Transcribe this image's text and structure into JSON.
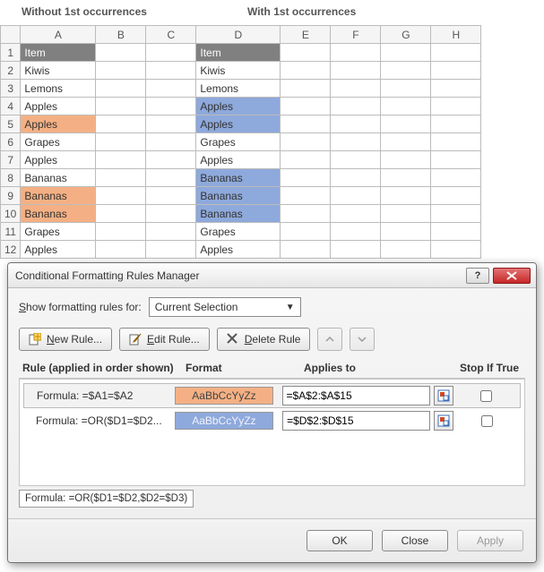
{
  "titles": {
    "left": "Without 1st occurrences",
    "right": "With 1st occurrences"
  },
  "grid": {
    "columns": [
      "A",
      "B",
      "C",
      "D",
      "E",
      "F",
      "G",
      "H"
    ],
    "header_label": "Item",
    "rows": [
      {
        "n": 1,
        "a": "Item",
        "d": "Item",
        "a_hdr": true,
        "d_hdr": true
      },
      {
        "n": 2,
        "a": "Kiwis",
        "d": "Kiwis"
      },
      {
        "n": 3,
        "a": "Lemons",
        "d": "Lemons"
      },
      {
        "n": 4,
        "a": "Apples",
        "d": "Apples",
        "d_hl": "blue"
      },
      {
        "n": 5,
        "a": "Apples",
        "d": "Apples",
        "a_hl": "orange",
        "d_hl": "blue"
      },
      {
        "n": 6,
        "a": "Grapes",
        "d": "Grapes"
      },
      {
        "n": 7,
        "a": "Apples",
        "d": "Apples"
      },
      {
        "n": 8,
        "a": "Bananas",
        "d": "Bananas",
        "d_hl": "blue"
      },
      {
        "n": 9,
        "a": "Bananas",
        "d": "Bananas",
        "a_hl": "orange",
        "d_hl": "blue"
      },
      {
        "n": 10,
        "a": "Bananas",
        "d": "Bananas",
        "a_hl": "orange",
        "d_hl": "blue"
      },
      {
        "n": 11,
        "a": "Grapes",
        "d": "Grapes"
      },
      {
        "n": 12,
        "a": "Apples",
        "d": "Apples"
      }
    ]
  },
  "dialog": {
    "title": "Conditional Formatting Rules Manager",
    "show_label_pre": "S",
    "show_label_post": "how formatting rules for:",
    "scope_value": "Current Selection",
    "buttons": {
      "new_pre": "N",
      "new": "ew Rule...",
      "edit_pre": "E",
      "edit": "dit Rule...",
      "delete_pre": "D",
      "delete": "elete Rule"
    },
    "headers": {
      "rule": "Rule (applied in order shown)",
      "format": "Format",
      "applies": "Applies to",
      "stop": "Stop If True"
    },
    "sample_text": "AaBbCcYyZz",
    "rules": [
      {
        "label": "Formula: =$A1=$A2",
        "swatch": "orange",
        "applies": "=$A$2:$A$15"
      },
      {
        "label": "Formula: =OR($D1=$D2...",
        "swatch": "blue",
        "applies": "=$D$2:$D$15"
      }
    ],
    "tooltip": "Formula: =OR($D1=$D2,$D2=$D3)",
    "footer": {
      "ok": "OK",
      "close": "Close",
      "apply": "Apply"
    }
  }
}
